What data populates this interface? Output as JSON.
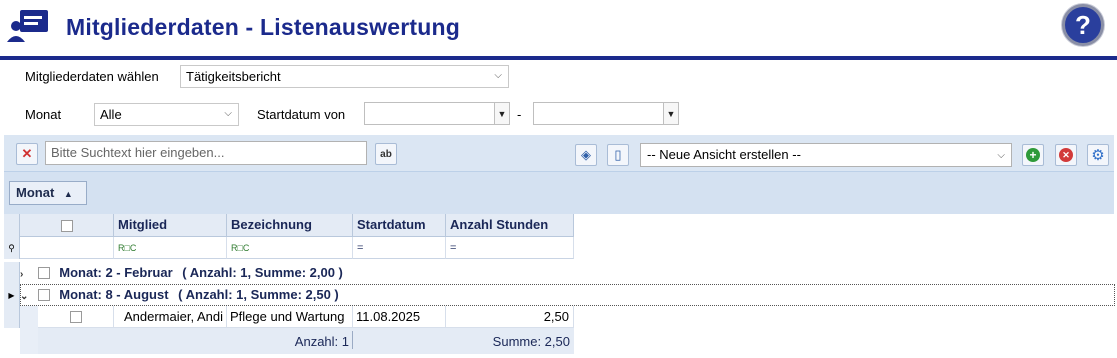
{
  "header": {
    "title": "Mitgliederdaten - Listenauswertung",
    "help_label": "?"
  },
  "form": {
    "member_data_label": "Mitgliederdaten wählen",
    "member_data_value": "Tätigkeitsbericht",
    "month_label": "Monat",
    "month_value": "Alle",
    "startdate_label": "Startdatum von",
    "startdate_from": "",
    "range_separator": "-",
    "startdate_to": ""
  },
  "toolbar": {
    "clear_icon": "close-icon",
    "search_placeholder": "Bitte Suchtext hier eingeben...",
    "spellcheck_label": "ab",
    "view_select_value": "-- Neue Ansicht erstellen --",
    "colors": {
      "add": "#2e9a3a",
      "delete": "#d23a3a",
      "settings": "#2f6fc9"
    }
  },
  "grouping": {
    "chip_label": "Monat",
    "chip_sort": "▲"
  },
  "table": {
    "columns": [
      "Mitglied",
      "Bezeichnung",
      "Startdatum",
      "Anzahl Stunden"
    ],
    "filter_row": [
      "R□C",
      "R□C",
      "=",
      "="
    ],
    "groups": [
      {
        "label": "Monat: 2 - Februar",
        "summary": "( Anzahl: 1, Summe: 2,00 )",
        "expanded": false,
        "rows": []
      },
      {
        "label": "Monat: 8 - August",
        "summary": "( Anzahl: 1, Summe: 2,50 )",
        "expanded": true,
        "rows": [
          {
            "mitglied": "Andermaier, Andi",
            "bezeichnung": "Pflege und Wartung",
            "startdatum": "11.08.2025",
            "stunden": "2,50"
          }
        ],
        "footer": {
          "anzahl": "Anzahl: 1",
          "summe": "Summe: 2,50"
        }
      }
    ]
  }
}
